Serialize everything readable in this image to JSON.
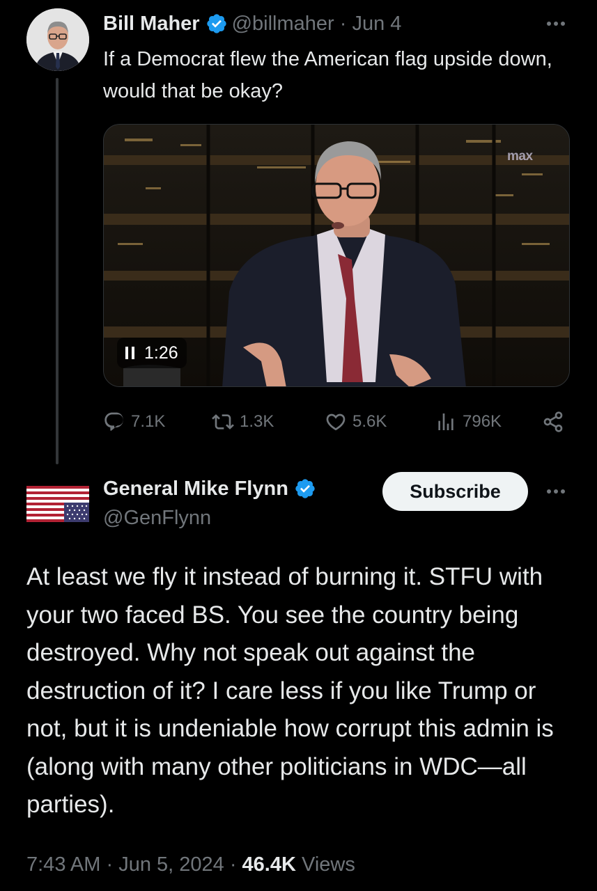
{
  "tweet1": {
    "name": "Bill Maher",
    "handle_date": "@billmaher · Jun 4",
    "text": "If a Democrat flew the American flag upside down, would that be okay?",
    "video": {
      "brand": "max",
      "timer": "1:26"
    },
    "actions": {
      "replies": "7.1K",
      "reposts": "1.3K",
      "likes": "5.6K",
      "views": "796K"
    }
  },
  "tweet2": {
    "name": "General Mike Flynn",
    "handle": "@GenFlynn",
    "subscribe_label": "Subscribe",
    "text": "At least we fly it instead of burning it. STFU with your two faced BS. You see the country being destroyed. Why not speak out against the destruction of it? I care less if you like Trump or not, but it is undeniable how corrupt this admin is (along with many other politicians in WDC—all parties).",
    "time": "7:43 AM",
    "date": "Jun 5, 2024",
    "views_count": "46.4K",
    "views_label": "Views"
  },
  "colors": {
    "background": "#000000",
    "text": "#e7e9ea",
    "muted": "#71767b",
    "verified": "#1d9bf0"
  }
}
